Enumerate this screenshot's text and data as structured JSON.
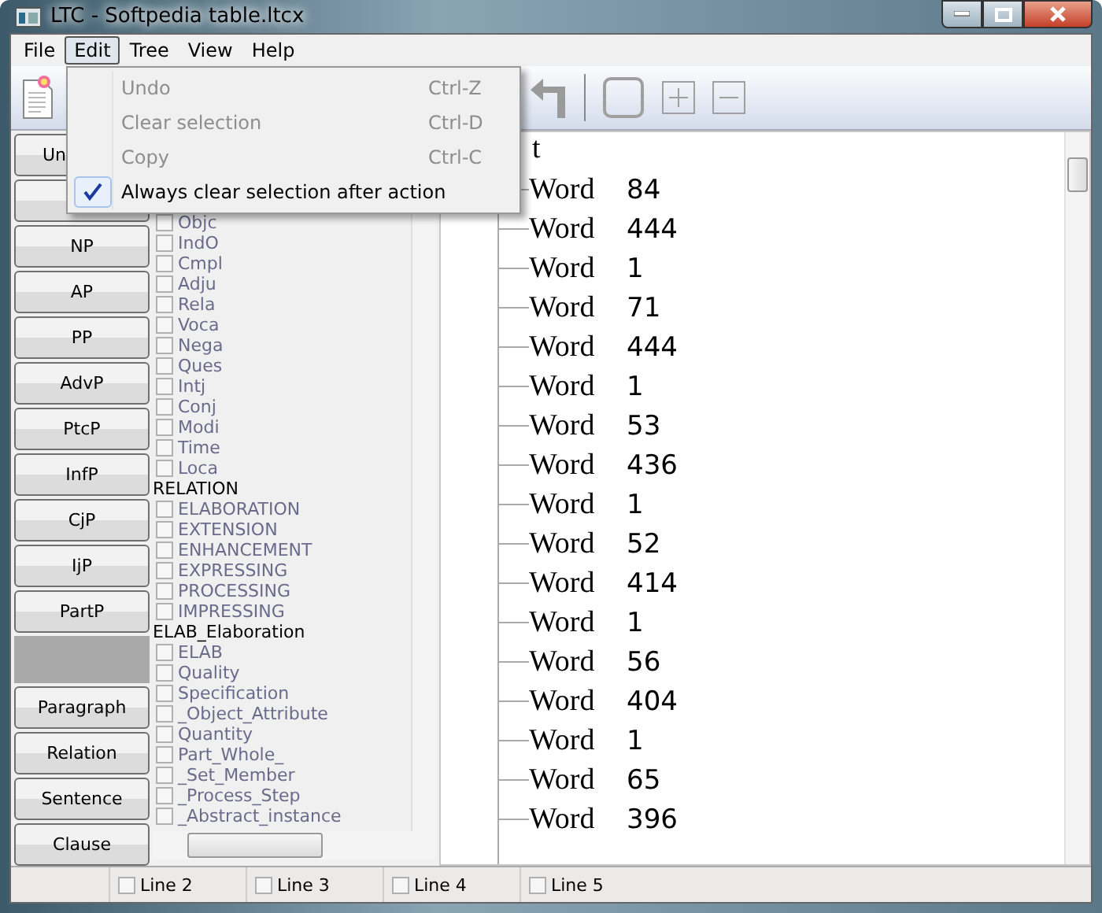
{
  "window": {
    "title": "LTC - Softpedia table.ltcx"
  },
  "menu_bar": [
    {
      "label": "File",
      "selected": false
    },
    {
      "label": "Edit",
      "selected": true
    },
    {
      "label": "Tree",
      "selected": false
    },
    {
      "label": "View",
      "selected": false
    },
    {
      "label": "Help",
      "selected": false
    }
  ],
  "edit_menu": [
    {
      "label": "Undo",
      "shortcut": "Ctrl-Z",
      "disabled": true,
      "checked": false
    },
    {
      "label": "Clear selection",
      "shortcut": "Ctrl-D",
      "disabled": true,
      "checked": false
    },
    {
      "label": "Copy",
      "shortcut": "Ctrl-C",
      "disabled": true,
      "checked": false
    },
    {
      "label": "Always clear selection after action",
      "disabled": false,
      "checked": true
    }
  ],
  "side_buttons": [
    {
      "kind": "partial",
      "label": "Un"
    },
    {
      "kind": "button"
    },
    {
      "kind": "button",
      "label": "NP"
    },
    {
      "kind": "button",
      "label": "AP"
    },
    {
      "kind": "button",
      "label": "PP"
    },
    {
      "kind": "button",
      "label": "AdvP"
    },
    {
      "kind": "button",
      "label": "PtcP"
    },
    {
      "kind": "button",
      "label": "InfP"
    },
    {
      "kind": "button",
      "label": "CjP"
    },
    {
      "kind": "button",
      "label": "IjP"
    },
    {
      "kind": "button",
      "label": "PartP"
    },
    {
      "kind": "spacer"
    },
    {
      "kind": "button",
      "label": "Paragraph"
    },
    {
      "kind": "button",
      "label": "Relation"
    },
    {
      "kind": "button",
      "label": "Sentence"
    },
    {
      "kind": "button",
      "label": "Clause"
    }
  ],
  "tag_list": [
    {
      "kind": "option",
      "label": "Objc",
      "checked": false
    },
    {
      "kind": "option",
      "label": "IndO",
      "checked": false
    },
    {
      "kind": "option",
      "label": "Cmpl",
      "checked": false
    },
    {
      "kind": "option",
      "label": "Adju",
      "checked": false
    },
    {
      "kind": "option",
      "label": "Rela",
      "checked": false
    },
    {
      "kind": "option",
      "label": "Voca",
      "checked": false
    },
    {
      "kind": "option",
      "label": "Nega",
      "checked": false
    },
    {
      "kind": "option",
      "label": "Ques",
      "checked": false
    },
    {
      "kind": "option",
      "label": "Intj",
      "checked": false
    },
    {
      "kind": "option",
      "label": "Conj",
      "checked": false
    },
    {
      "kind": "option",
      "label": "Modi",
      "checked": false
    },
    {
      "kind": "option",
      "label": "Time",
      "checked": false
    },
    {
      "kind": "option",
      "label": "Loca",
      "checked": false
    },
    {
      "kind": "heading",
      "label": "RELATION"
    },
    {
      "kind": "option",
      "label": "ELABORATION",
      "checked": false
    },
    {
      "kind": "option",
      "label": "EXTENSION",
      "checked": false
    },
    {
      "kind": "option",
      "label": "ENHANCEMENT",
      "checked": false
    },
    {
      "kind": "option",
      "label": "EXPRESSING",
      "checked": false
    },
    {
      "kind": "option",
      "label": "PROCESSING",
      "checked": false
    },
    {
      "kind": "option",
      "label": "IMPRESSING",
      "checked": false
    },
    {
      "kind": "heading",
      "label": "ELAB_Elaboration"
    },
    {
      "kind": "option",
      "label": "ELAB",
      "checked": false
    },
    {
      "kind": "option",
      "label": "Quality",
      "checked": false
    },
    {
      "kind": "option",
      "label": "Specification",
      "checked": false
    },
    {
      "kind": "option",
      "label": "_Object_Attribute",
      "checked": false
    },
    {
      "kind": "option",
      "label": "Quantity",
      "checked": false
    },
    {
      "kind": "option",
      "label": "Part_Whole_",
      "checked": false
    },
    {
      "kind": "option",
      "label": "_Set_Member",
      "checked": false
    },
    {
      "kind": "option",
      "label": "_Process_Step",
      "checked": false
    },
    {
      "kind": "option",
      "label": "_Abstract_instance",
      "checked": false
    }
  ],
  "tree": {
    "root": "t",
    "rows": [
      {
        "word": "Word",
        "number": "84"
      },
      {
        "word": "Word",
        "number": "444"
      },
      {
        "word": "Word",
        "number": "1"
      },
      {
        "word": "Word",
        "number": "71"
      },
      {
        "word": "Word",
        "number": "444"
      },
      {
        "word": "Word",
        "number": "1"
      },
      {
        "word": "Word",
        "number": "53"
      },
      {
        "word": "Word",
        "number": "436"
      },
      {
        "word": "Word",
        "number": "1"
      },
      {
        "word": "Word",
        "number": "52"
      },
      {
        "word": "Word",
        "number": "414"
      },
      {
        "word": "Word",
        "number": "1"
      },
      {
        "word": "Word",
        "number": "56"
      },
      {
        "word": "Word",
        "number": "404"
      },
      {
        "word": "Word",
        "number": "1"
      },
      {
        "word": "Word",
        "number": "65"
      },
      {
        "word": "Word",
        "number": "396"
      }
    ]
  },
  "status_bar": [
    {
      "label": "Line 2",
      "checked": false
    },
    {
      "label": "Line 3",
      "checked": false
    },
    {
      "label": "Line 4",
      "checked": false
    },
    {
      "label": "Line 5",
      "checked": false
    }
  ]
}
